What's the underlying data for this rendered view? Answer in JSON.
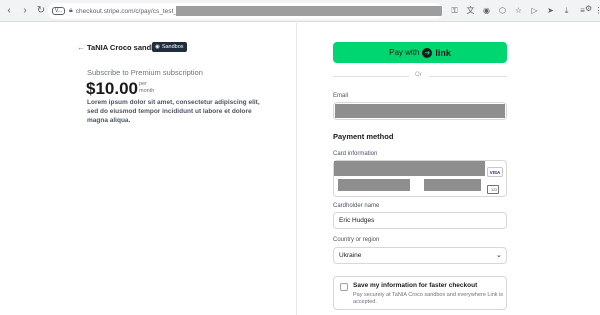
{
  "browser": {
    "version_chip": "V...",
    "url_text": "checkout.stripe.com/c/pay/cs_test_a1du3iRmU..."
  },
  "merchant": {
    "back_arrow": "←",
    "name": "TaNIA Croco sandbox",
    "sandbox_badge": "Sandbox"
  },
  "summary": {
    "subtitle": "Subscribe to Premium subscription",
    "price": "$10.00",
    "per": "per",
    "period": "month",
    "description": "Lorem ipsum dolor sit amet, consectetur adipiscing elit, sed do eiusmod tempor incididunt ut labore et dolore magna aliqua."
  },
  "payment": {
    "pay_label": "Pay with",
    "link_label": "link",
    "or_label": "Or",
    "email_label": "Email",
    "method_heading": "Payment method",
    "card_info_label": "Card information",
    "card_brand": "VISA",
    "cvc_hint": "123",
    "cardholder_label": "Cardholder name",
    "cardholder_value": "Eric Hudges",
    "country_label": "Country or region",
    "country_value": "Ukraine",
    "save_title": "Save my information for faster checkout",
    "save_desc": "Pay securely at TaNIA Croco sandbox and everywhere Link is accepted."
  },
  "colors": {
    "link_green": "#00d66f",
    "badge_dark": "#1f2d3d"
  }
}
